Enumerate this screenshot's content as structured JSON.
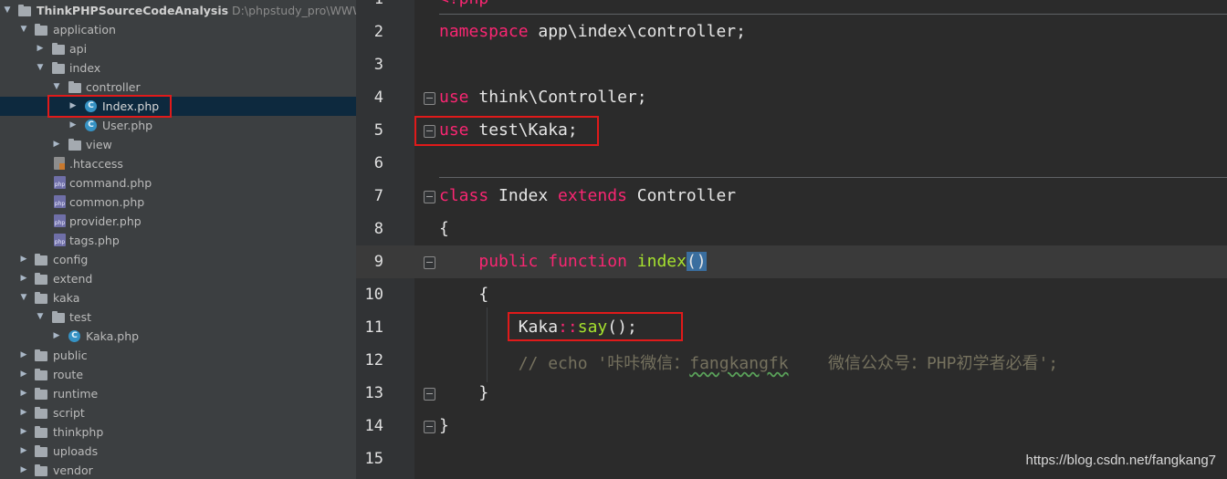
{
  "project_tree": {
    "project_name": "ThinkPHPSourceCodeAnalysis",
    "project_path": "D:\\phpstudy_pro\\WWW\\Thi",
    "items": [
      {
        "label": "application"
      },
      {
        "label": "api"
      },
      {
        "label": "index"
      },
      {
        "label": "controller"
      },
      {
        "label": "Index.php"
      },
      {
        "label": "User.php"
      },
      {
        "label": "view"
      },
      {
        "label": ".htaccess"
      },
      {
        "label": "command.php"
      },
      {
        "label": "common.php"
      },
      {
        "label": "provider.php"
      },
      {
        "label": "tags.php"
      },
      {
        "label": "config"
      },
      {
        "label": "extend"
      },
      {
        "label": "kaka"
      },
      {
        "label": "test"
      },
      {
        "label": "Kaka.php"
      },
      {
        "label": "public"
      },
      {
        "label": "route"
      },
      {
        "label": "runtime"
      },
      {
        "label": "script"
      },
      {
        "label": "thinkphp"
      },
      {
        "label": "uploads"
      },
      {
        "label": "vendor"
      }
    ]
  },
  "editor": {
    "line_numbers": [
      "1",
      "2",
      "3",
      "4",
      "5",
      "6",
      "7",
      "8",
      "9",
      "10",
      "11",
      "12",
      "13",
      "14",
      "15"
    ],
    "tokens": {
      "l1": "<?php",
      "l2_kw": "namespace",
      "l2_rest": " app\\index\\controller;",
      "l4_kw": "use",
      "l4_rest": " think\\Controller;",
      "l5_kw": "use",
      "l5_rest": " test\\Kaka;",
      "l7_kw1": "class",
      "l7_mid": " Index ",
      "l7_kw2": "extends",
      "l7_rest": " Controller",
      "l8": "{",
      "l9_indent": "    ",
      "l9_kw1": "public",
      "l9_sp": " ",
      "l9_kw2": "function",
      "l9_sp2": " ",
      "l9_fn": "index",
      "l9_paren": "()",
      "l10": "    {",
      "l11_indent": "        ",
      "l11_cls": "Kaka",
      "l11_op": "::",
      "l11_fn": "say",
      "l11_rest": "();",
      "l12_a": "        // echo '咔咔微信：",
      "l12_b": "fangkangfk",
      "l12_c": "    微信公众号：PHP初学者必看';",
      "l13": "    }",
      "l14": "}"
    }
  },
  "watermark": "https://blog.csdn.net/fangkang7",
  "colors": {
    "keyword": "#f92672",
    "function": "#a6e22e",
    "comment": "#75715e",
    "highlight_box": "#e01a1a"
  }
}
